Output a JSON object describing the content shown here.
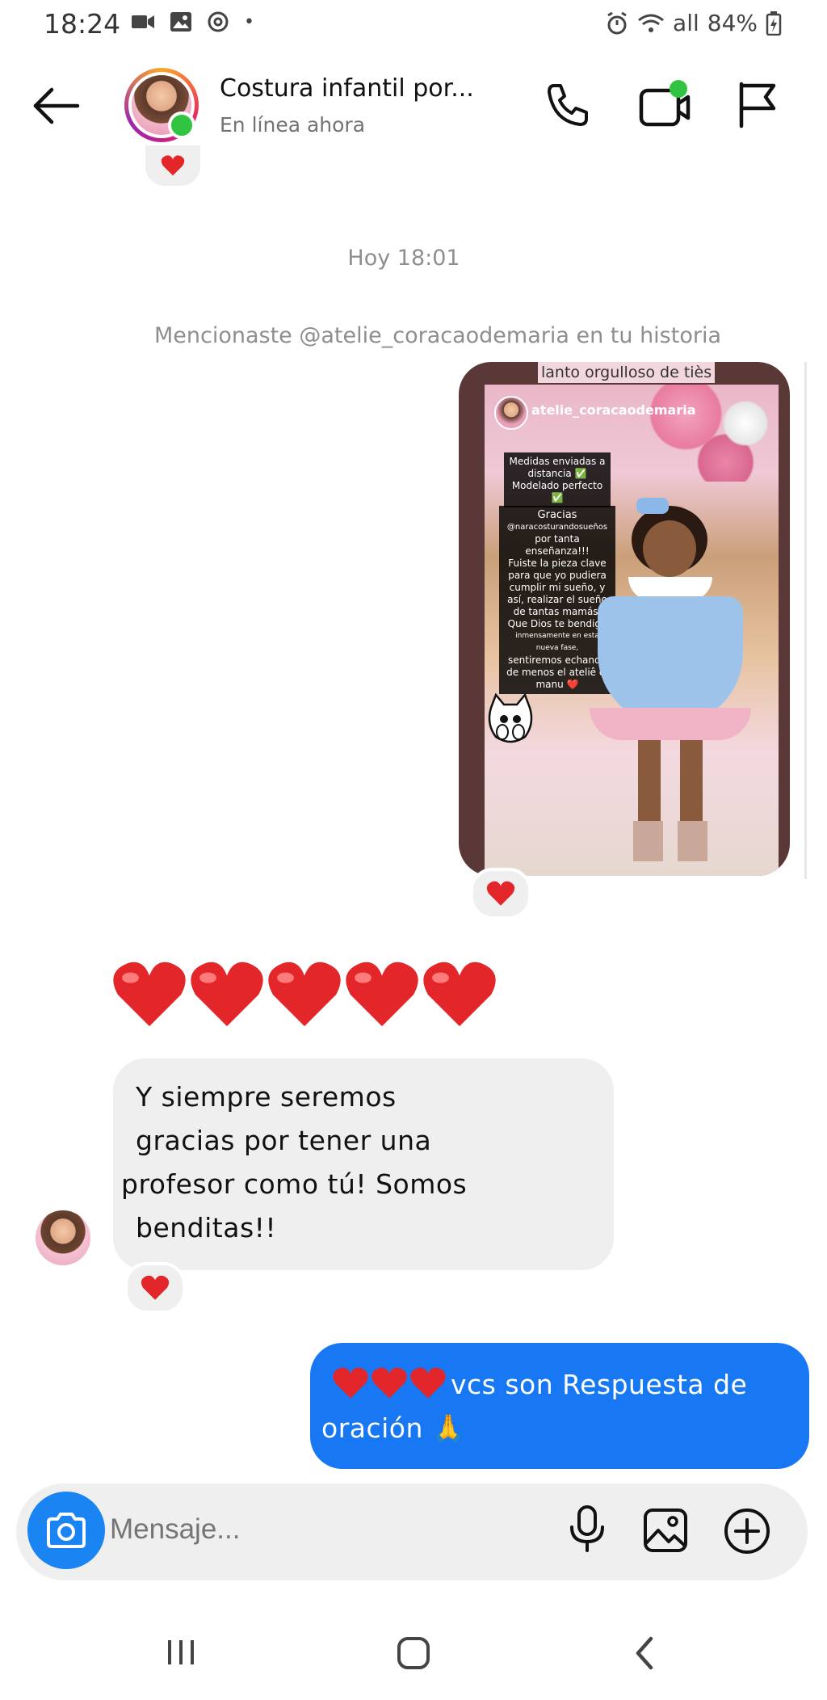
{
  "status_bar": {
    "time": "18:24",
    "dot": "•",
    "battery": "84%",
    "signal_label": "all",
    "icons": [
      "video-camera-icon",
      "gallery-icon",
      "threads-icon",
      "alarm-icon",
      "wifi-icon",
      "battery-icon"
    ]
  },
  "header": {
    "contact_name": "Costura infantil por...",
    "status": "En línea ahora",
    "icons": [
      "back-arrow-icon",
      "phone-icon",
      "video-call-icon",
      "flag-icon"
    ]
  },
  "conversation": {
    "timestamp": "Hoy 18:01",
    "mention_notice": "Mencionaste @atelie_coracaodemaria en tu historia",
    "story": {
      "caption": "lanto orgulloso de tiès",
      "handle": "atelie_coracaodemaria",
      "box1_line1": "Medidas enviadas a",
      "box1_line2": "distancia ✅",
      "box1_line3": "Modelado perfecto ✅",
      "box2_line1": "Gracias",
      "box2_line2": "@naracosturandosueños",
      "box2_line3": "por tanta enseñanza!!!",
      "box2_line4": "Fuiste la pieza clave",
      "box2_line5": "para que yo pudiera",
      "box2_line6": "cumplir mi sueño, y",
      "box2_line7": "así, realizar el sueño",
      "box2_line8": "de tantas mamás.",
      "box2_line9": "Que Dios te bendiga",
      "box2_line10": "inmensamente en esta nueva fase,",
      "box2_line11": "sentiremos echando",
      "box2_line12": "de menos el ateliê di",
      "box2_line13": "manu ❤️"
    },
    "incoming_text": {
      "line1": "Y siempre seremos",
      "line2": "gracias por tener una",
      "line3": "profesor como tú! Somos",
      "line4": "benditas!!"
    },
    "outgoing_text": {
      "line1": "vcs son Respuesta de",
      "line2": "oración 🙏"
    }
  },
  "composer": {
    "placeholder": "Mensaje..."
  },
  "colors": {
    "accent_blue": "#1877f2",
    "heart_red": "#e3262a",
    "bubble_gray": "#efefef",
    "online_green": "#31c441"
  }
}
